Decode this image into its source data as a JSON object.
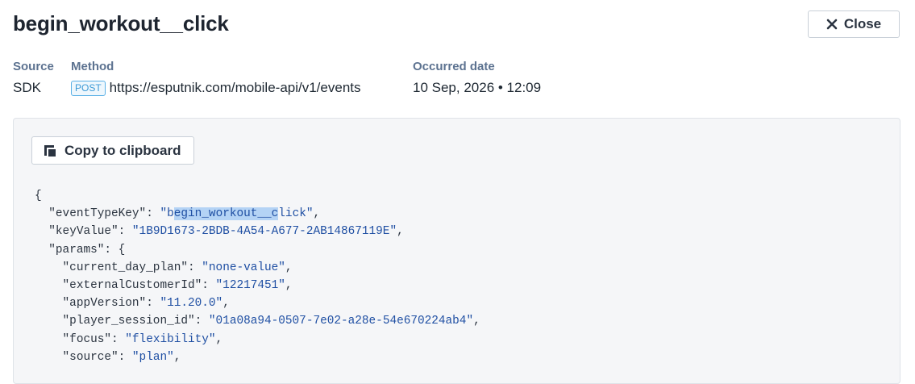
{
  "header": {
    "title": "begin_workout__click",
    "close_label": "Close"
  },
  "meta": {
    "source_label": "Source",
    "source_value": "SDK",
    "method_label": "Method",
    "method_badge": "POST",
    "method_url": "https://esputnik.com/mobile-api/v1/events",
    "date_label": "Occurred date",
    "date_value": "10 Sep, 2026 • 12:09"
  },
  "panel": {
    "copy_label": "Copy to clipboard"
  },
  "code": {
    "open_brace": "{",
    "event_type_key": {
      "key": "\"eventTypeKey\"",
      "value_pre": "\"b",
      "value_selected": "egin_workout__c",
      "value_post": "lick\""
    },
    "key_value": {
      "key": "\"keyValue\"",
      "value": "\"1B9D1673-2BDB-4A54-A677-2AB14867119E\""
    },
    "params_key": "\"params\"",
    "params_open": "{",
    "params": [
      {
        "key": "\"current_day_plan\"",
        "value": "\"none-value\""
      },
      {
        "key": "\"externalCustomerId\"",
        "value": "\"12217451\""
      },
      {
        "key": "\"appVersion\"",
        "value": "\"11.20.0\""
      },
      {
        "key": "\"player_session_id\"",
        "value": "\"01a08a94-0507-7e02-a28e-54e670224ab4\""
      },
      {
        "key": "\"focus\"",
        "value": "\"flexibility\""
      },
      {
        "key": "\"source\"",
        "value": "\"plan\""
      }
    ]
  },
  "colors": {
    "code_string": "#1f4fa3",
    "label": "#5c7290",
    "selection": "#b4d3f5",
    "badge_border": "#5ab0e6"
  }
}
